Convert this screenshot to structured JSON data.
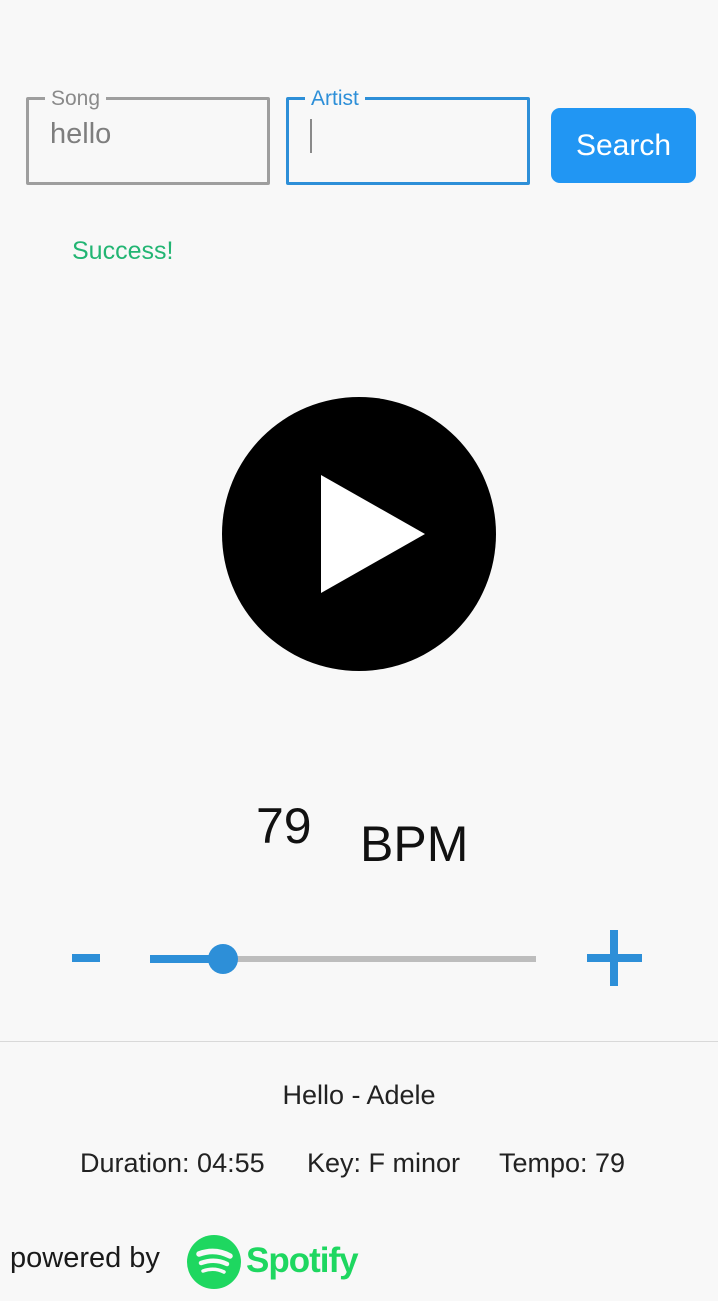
{
  "search": {
    "song_label": "Song",
    "song_value": "hello",
    "artist_label": "Artist",
    "artist_value": "",
    "button_label": "Search"
  },
  "status": {
    "text": "Success!",
    "color": "#22b573"
  },
  "player": {
    "play_icon": "play-icon"
  },
  "tempo": {
    "bpm_value": "79",
    "bpm_label": "BPM",
    "decrement_label": "-",
    "increment_label": "+",
    "slider_fraction": 0.19
  },
  "track": {
    "title": "Hello - Adele",
    "duration": "Duration: 04:55",
    "key": "Key: F minor",
    "tempo": "Tempo: 79"
  },
  "footer": {
    "powered_by": "powered by",
    "brand": "Spotify",
    "brand_icon": "spotify-logo-icon",
    "brand_color": "#1ed760"
  },
  "colors": {
    "accent": "#2d8fd8",
    "button": "#2196f3",
    "play_button": "#000000"
  }
}
